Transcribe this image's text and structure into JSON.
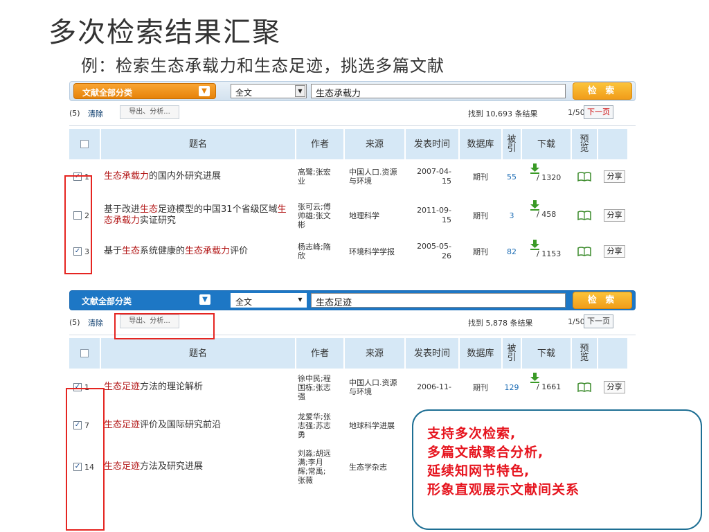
{
  "slide": {
    "title": "多次检索结果汇聚",
    "subtitle": "例：检索生态承载力和生态足迹，挑选多篇文献"
  },
  "panel1": {
    "category": "文献全部分类",
    "field": "全文",
    "query": "生态承载力",
    "search_button": "检 索",
    "selected_count": "(5)",
    "clear": "清除",
    "export": "导出、分析...",
    "results": "找到 10,693 条结果",
    "page": "1/50",
    "next": "下一页",
    "headers": [
      "题名",
      "作者",
      "来源",
      "发表时间",
      "数据库",
      "被引",
      "下载",
      "预览"
    ],
    "rows": [
      {
        "checked": true,
        "index": "1",
        "title_parts": [
          {
            "t": "生态承载力",
            "hl": true
          },
          {
            "t": "的国内外研究进展",
            "hl": false
          }
        ],
        "author": "高鹭;张宏业",
        "source": "中国人口.资源与环境",
        "date": "2007-04-15",
        "db": "期刊",
        "cites": "55",
        "downloads": "/ 1320",
        "share": "分享"
      },
      {
        "checked": false,
        "index": "2",
        "title_parts": [
          {
            "t": "基于改进",
            "hl": false
          },
          {
            "t": "生态",
            "hl": true
          },
          {
            "t": "足迹模型的中国31个省级区域",
            "hl": false
          },
          {
            "t": "生态承载力",
            "hl": true
          },
          {
            "t": "实证研究",
            "hl": false
          }
        ],
        "author": "张可云;傅帅雄;张文彬",
        "source": "地理科学",
        "date": "2011-09-15",
        "db": "期刊",
        "cites": "3",
        "downloads": "/ 458",
        "share": "分享"
      },
      {
        "checked": true,
        "index": "3",
        "title_parts": [
          {
            "t": "基于",
            "hl": false
          },
          {
            "t": "生态",
            "hl": true
          },
          {
            "t": "系统健康的",
            "hl": false
          },
          {
            "t": "生态承载力",
            "hl": true
          },
          {
            "t": "评价",
            "hl": false
          }
        ],
        "author": "杨志峰;隋欣",
        "source": "环境科学学报",
        "date": "2005-05-26",
        "db": "期刊",
        "cites": "82",
        "downloads": "/ 1153",
        "share": "分享"
      }
    ]
  },
  "panel2": {
    "category": "文献全部分类",
    "field": "全文",
    "query": "生态足迹",
    "search_button": "检 索",
    "selected_count": "(5)",
    "clear": "清除",
    "export": "导出、分析...",
    "results": "找到 5,878 条结果",
    "page": "1/50",
    "next": "下一页",
    "headers": [
      "题名",
      "作者",
      "来源",
      "发表时间",
      "数据库",
      "被引",
      "下载",
      "预览"
    ],
    "rows": [
      {
        "checked": true,
        "index": "1",
        "title_parts": [
          {
            "t": "生态足迹",
            "hl": true
          },
          {
            "t": "方法的理论解析",
            "hl": false
          }
        ],
        "author": "徐中民;程国栋;张志强",
        "source": "中国人口.资源与环境",
        "date": "2006-11-",
        "db": "期刊",
        "cites": "129",
        "downloads": "/ 1661",
        "share": "分享"
      },
      {
        "checked": true,
        "index": "7",
        "title_parts": [
          {
            "t": "生态足迹",
            "hl": true
          },
          {
            "t": "评价及国际研究前沿",
            "hl": false
          }
        ],
        "author": "龙爱华;张志强;苏志勇",
        "source": "地球科学进展",
        "date": "",
        "db": "",
        "cites": "",
        "downloads": "",
        "share": ""
      },
      {
        "checked": true,
        "index": "14",
        "title_parts": [
          {
            "t": "生态足迹",
            "hl": true
          },
          {
            "t": "方法及研究进展",
            "hl": false
          }
        ],
        "author": "刘淼;胡远满;李月辉;常禹;张薇",
        "source": "生态学杂志",
        "date": "",
        "db": "",
        "cites": "",
        "downloads": "",
        "share": ""
      }
    ]
  },
  "callout": {
    "lines": [
      "支持多次检索,",
      "多篇文献聚合分析,",
      "延续知网节特色,",
      "形象直观展示文献间关系"
    ]
  },
  "colors": {
    "highlight": "#b31818",
    "orange": "#f0961a",
    "blue_bar": "#1d77c5",
    "header_bg": "#d6e8f6",
    "annotation_red": "#e52521",
    "callout_border": "#1e6f94"
  }
}
